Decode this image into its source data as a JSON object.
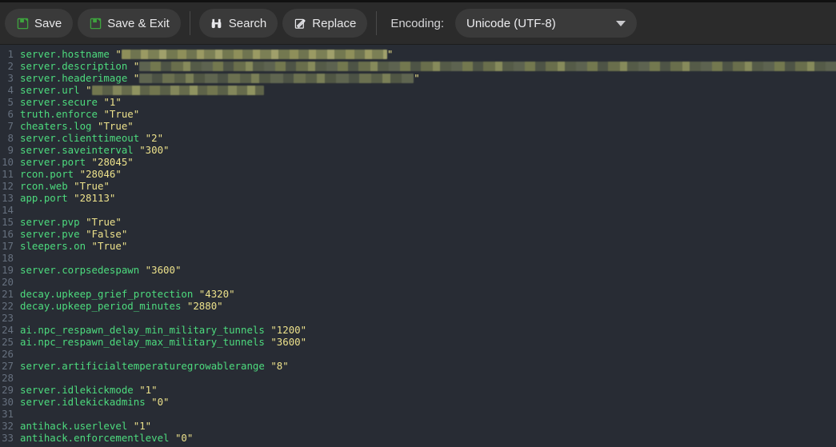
{
  "toolbar": {
    "buttons": [
      {
        "id": "save",
        "label": "Save",
        "icon": "floppy-disk-icon"
      },
      {
        "id": "save-exit",
        "label": "Save & Exit",
        "icon": "floppy-disk-icon"
      },
      {
        "id": "search",
        "label": "Search",
        "icon": "binoculars-icon"
      },
      {
        "id": "replace",
        "label": "Replace",
        "icon": "pencil-edit-icon"
      }
    ],
    "encoding_label": "Encoding:",
    "encoding_value": "Unicode (UTF-8)",
    "encoding_options": [
      "Unicode (UTF-8)"
    ]
  },
  "colors": {
    "toolbar_bg": "#2b2b2b",
    "button_bg": "#3a3a3a",
    "editor_bg": "#282c34",
    "line_number": "#66707e",
    "key_green": "#4ddb7e",
    "string_yellow": "#ece18b",
    "save_icon_green": "#3ea33e"
  },
  "editor": {
    "lines": [
      {
        "n": 1,
        "key": "server.hostname",
        "redacted": true,
        "redact_style": "a",
        "redact_width": 332,
        "quote_close": true,
        "value": ""
      },
      {
        "n": 2,
        "key": "server.description",
        "redacted": true,
        "redact_style": "b",
        "redact_width": 880,
        "quote_close": false,
        "value": ""
      },
      {
        "n": 3,
        "key": "server.headerimage",
        "redacted": true,
        "redact_style": "c",
        "redact_width": 343,
        "quote_close": true,
        "value": ""
      },
      {
        "n": 4,
        "key": "server.url",
        "redacted": true,
        "redact_style": "d",
        "redact_width": 215,
        "quote_close": false,
        "value": ""
      },
      {
        "n": 5,
        "key": "server.secure",
        "redacted": false,
        "value": "1"
      },
      {
        "n": 6,
        "key": "truth.enforce",
        "redacted": false,
        "value": "True"
      },
      {
        "n": 7,
        "key": "cheaters.log",
        "redacted": false,
        "value": "True"
      },
      {
        "n": 8,
        "key": "server.clienttimeout",
        "redacted": false,
        "value": "2"
      },
      {
        "n": 9,
        "key": "server.saveinterval",
        "redacted": false,
        "value": "300"
      },
      {
        "n": 10,
        "key": "server.port",
        "redacted": false,
        "value": "28045"
      },
      {
        "n": 11,
        "key": "rcon.port",
        "redacted": false,
        "value": "28046"
      },
      {
        "n": 12,
        "key": "rcon.web",
        "redacted": false,
        "value": "True"
      },
      {
        "n": 13,
        "key": "app.port",
        "redacted": false,
        "value": "28113"
      },
      {
        "n": 14,
        "key": "",
        "redacted": false,
        "value": null
      },
      {
        "n": 15,
        "key": "server.pvp",
        "redacted": false,
        "value": "True"
      },
      {
        "n": 16,
        "key": "server.pve",
        "redacted": false,
        "value": "False"
      },
      {
        "n": 17,
        "key": "sleepers.on",
        "redacted": false,
        "value": "True"
      },
      {
        "n": 18,
        "key": "",
        "redacted": false,
        "value": null
      },
      {
        "n": 19,
        "key": "server.corpsedespawn",
        "redacted": false,
        "value": "3600"
      },
      {
        "n": 20,
        "key": "",
        "redacted": false,
        "value": null
      },
      {
        "n": 21,
        "key": "decay.upkeep_grief_protection",
        "redacted": false,
        "value": "4320"
      },
      {
        "n": 22,
        "key": "decay.upkeep_period_minutes",
        "redacted": false,
        "value": "2880"
      },
      {
        "n": 23,
        "key": "",
        "redacted": false,
        "value": null
      },
      {
        "n": 24,
        "key": "ai.npc_respawn_delay_min_military_tunnels",
        "redacted": false,
        "value": "1200"
      },
      {
        "n": 25,
        "key": "ai.npc_respawn_delay_max_military_tunnels",
        "redacted": false,
        "value": "3600"
      },
      {
        "n": 26,
        "key": "",
        "redacted": false,
        "value": null
      },
      {
        "n": 27,
        "key": "server.artificialtemperaturegrowablerange",
        "redacted": false,
        "value": "8"
      },
      {
        "n": 28,
        "key": "",
        "redacted": false,
        "value": null
      },
      {
        "n": 29,
        "key": "server.idlekickmode",
        "redacted": false,
        "value": "1"
      },
      {
        "n": 30,
        "key": "server.idlekickadmins",
        "redacted": false,
        "value": "0"
      },
      {
        "n": 31,
        "key": "",
        "redacted": false,
        "value": null
      },
      {
        "n": 32,
        "key": "antihack.userlevel",
        "redacted": false,
        "value": "1"
      },
      {
        "n": 33,
        "key": "antihack.enforcementlevel",
        "redacted": false,
        "value": "0"
      }
    ]
  }
}
